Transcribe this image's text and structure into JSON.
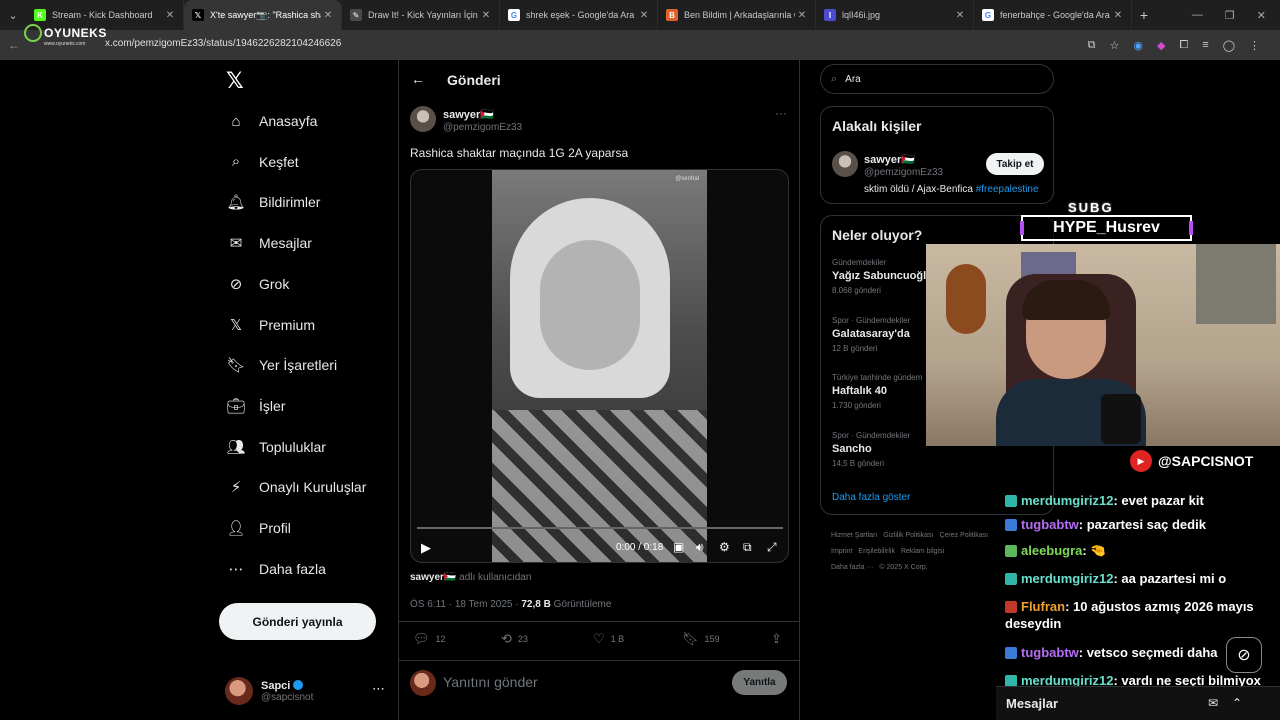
{
  "browser": {
    "tabs": [
      {
        "label": "Stream - Kick Dashboard",
        "fav_color": "#53fc18",
        "fav_char": "K",
        "active": false
      },
      {
        "label": "X'te sawyer📷: \"Rashica shaktar",
        "fav_color": "#000000",
        "fav_char": "𝕏",
        "active": true
      },
      {
        "label": "Draw It! - Kick Yayınları İçin Çiz",
        "fav_color": "#4a4a4a",
        "fav_char": "✎",
        "active": false
      },
      {
        "label": "shrek eşek - Google'da Ara",
        "fav_color": "#ffffff",
        "fav_char": "G",
        "active": false
      },
      {
        "label": "Ben Bildim | Arkadaşlarınla Onl",
        "fav_color": "#e0602a",
        "fav_char": "B",
        "active": false
      },
      {
        "label": "lqlI46i.jpg",
        "fav_color": "#4b4bd1",
        "fav_char": "I",
        "active": false
      },
      {
        "label": "fenerbahçe - Google'da Ara",
        "fav_color": "#ffffff",
        "fav_char": "G",
        "active": false
      }
    ],
    "url": "x.com/pemzigomEz33/status/1946226282104246626",
    "overlay_logo": "OYUNEKS",
    "overlay_logo_sub": "www.oyuneks.com"
  },
  "nav": {
    "items": [
      {
        "label": "Anasayfa",
        "icon": "⌂"
      },
      {
        "label": "Keşfet",
        "icon": "⌕"
      },
      {
        "label": "Bildirimler",
        "icon": "🔔︎"
      },
      {
        "label": "Mesajlar",
        "icon": "✉"
      },
      {
        "label": "Grok",
        "icon": "⊘"
      },
      {
        "label": "Premium",
        "icon": "𝕏"
      },
      {
        "label": "Yer İşaretleri",
        "icon": "🔖︎"
      },
      {
        "label": "İşler",
        "icon": "💼︎"
      },
      {
        "label": "Topluluklar",
        "icon": "👥︎"
      },
      {
        "label": "Onaylı Kuruluşlar",
        "icon": "⚡︎"
      },
      {
        "label": "Profil",
        "icon": "👤︎"
      },
      {
        "label": "Daha fazla",
        "icon": "⋯"
      }
    ],
    "post_button": "Gönderi yayınla",
    "account": {
      "name": "Sapci",
      "handle": "@sapcisnot"
    }
  },
  "post": {
    "header_title": "Gönderi",
    "author_name": "sawyer🇵🇸",
    "author_handle": "@pemzigomEz33",
    "text": "Rashica shaktar maçında 1G 2A yaparsa",
    "video_watermark": "@senhal",
    "video_time": "0:00 / 0:18",
    "source_user": "sawyer🇵🇸",
    "source_suffix": "adlı kullanıcıdan",
    "meta_time": "ÖS 6:11 · 18 Tem 2025 · ",
    "meta_views": "72,8 B",
    "meta_views_label": " Görüntüleme",
    "replies": "12",
    "reposts": "23",
    "likes": "1 B",
    "bookmarks": "159",
    "reply_placeholder": "Yanıtını gönder",
    "reply_button": "Yanıtla"
  },
  "right": {
    "search_placeholder": "Ara",
    "relevant_title": "Alakalı kişiler",
    "relevant_user": {
      "name": "sawyer🇵🇸",
      "handle": "@pemzigomEz33",
      "bio": "sktim öldü / Ajax-Benfica ",
      "bio_tag": "#freepalestine",
      "follow": "Takip et"
    },
    "trends_title": "Neler oluyor?",
    "trends": [
      {
        "category": "Gündemdekiler",
        "title": "Yağız Sabuncuoğlu",
        "count": "8.068 gönderi"
      },
      {
        "category": "Spor · Gündemdekiler",
        "title": "Galatasaray'da",
        "count": "12 B gönderi"
      },
      {
        "category": "Türkiye tarihinde gündem",
        "title": "Haftalık 40",
        "count": "1.730 gönderi"
      },
      {
        "category": "Spor · Gündemdekiler",
        "title": "Sancho",
        "count": "14,5 B gönderi"
      }
    ],
    "show_more": "Daha fazla göster",
    "footer": [
      "Hizmet Şartları",
      "Gizlilik Politikası",
      "Çerez Politikası",
      "Imprint",
      "Erişilebilirlik",
      "Reklam bilgisi",
      "Daha fazla ···",
      "© 2025 X Corp."
    ]
  },
  "stream": {
    "subg_label": "SUBG",
    "hype_label": "HYPE_Husrev",
    "youtube_name": "@SAPCISNOT",
    "chat": [
      {
        "user": "merdumgiriz12",
        "msg": ": evet pazar kit",
        "color": "cyan"
      },
      {
        "user": "tugbabtw",
        "msg": ": pazartesi saç dedik",
        "color": "purple"
      },
      {
        "user": "aleebugra",
        "msg": ": 🤏",
        "color": "green"
      },
      {
        "user": "merdumgiriz12",
        "msg": ": aa pazartesi mi o",
        "color": "cyan"
      },
      {
        "user": "Flufran",
        "msg": ": 10 ağustos azmış 2026 mayıs deseydin",
        "color": "orange"
      },
      {
        "user": "tugbabtw",
        "msg": ": vetsco seçmedi daha",
        "color": "purple"
      },
      {
        "user": "merdumgiriz12",
        "msg": ": vardı ne seçti bilmiyox",
        "color": "cyan"
      }
    ],
    "messages_label": "Mesajlar"
  }
}
